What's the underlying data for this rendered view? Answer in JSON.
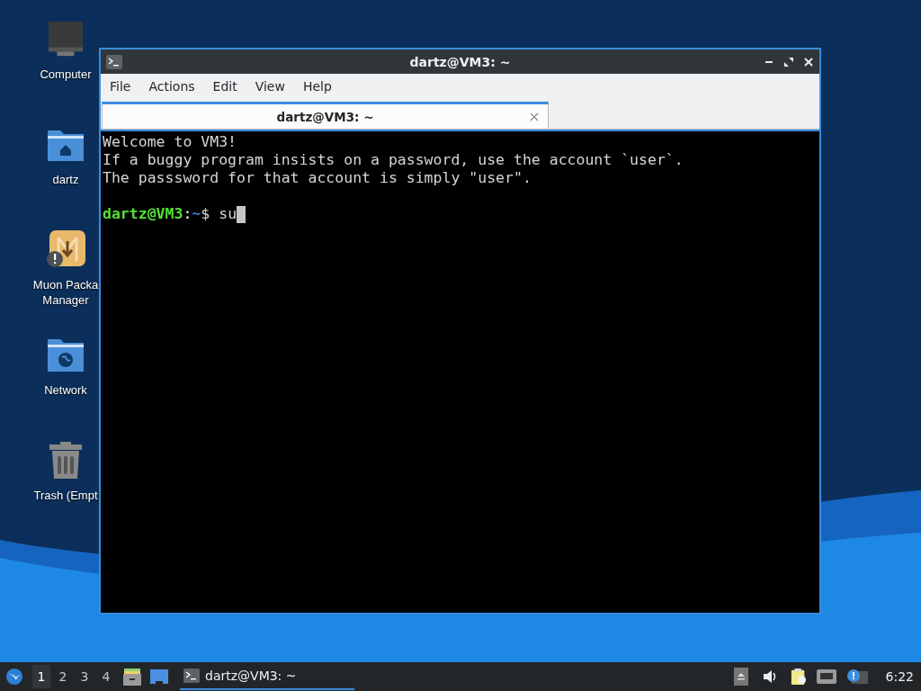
{
  "desktop_icons": [
    {
      "kind": "computer",
      "label_lines": [
        "Computer"
      ]
    },
    {
      "kind": "home-folder",
      "label_lines": [
        "dartz"
      ]
    },
    {
      "kind": "package-manager",
      "label_lines": [
        "Muon Packa",
        "Manager"
      ]
    },
    {
      "kind": "network-folder",
      "label_lines": [
        "Network"
      ]
    },
    {
      "kind": "trash",
      "label_lines": [
        "Trash (Empt"
      ]
    }
  ],
  "window": {
    "title": "dartz@VM3: ~",
    "menu": [
      "File",
      "Actions",
      "Edit",
      "View",
      "Help"
    ],
    "tabs": [
      {
        "label": "dartz@VM3: ~",
        "selected": true
      }
    ],
    "terminal": {
      "lines": [
        "Welcome to VM3!",
        "If a buggy program insists on a password, use the account `user`.",
        "The passsword for that account is simply \"user\"."
      ],
      "prompt": {
        "user_host": "dartz@VM3",
        "separator": ":",
        "path": "~",
        "symbol": "$",
        "command": "su"
      }
    }
  },
  "taskbar": {
    "workspaces": [
      {
        "label": "1",
        "selected": true
      },
      {
        "label": "2",
        "selected": false
      },
      {
        "label": "3",
        "selected": false
      },
      {
        "label": "4",
        "selected": false
      }
    ],
    "tasks": [
      {
        "title": "dartz@VM3: ~",
        "selected": true
      }
    ],
    "clock": "6:22"
  }
}
